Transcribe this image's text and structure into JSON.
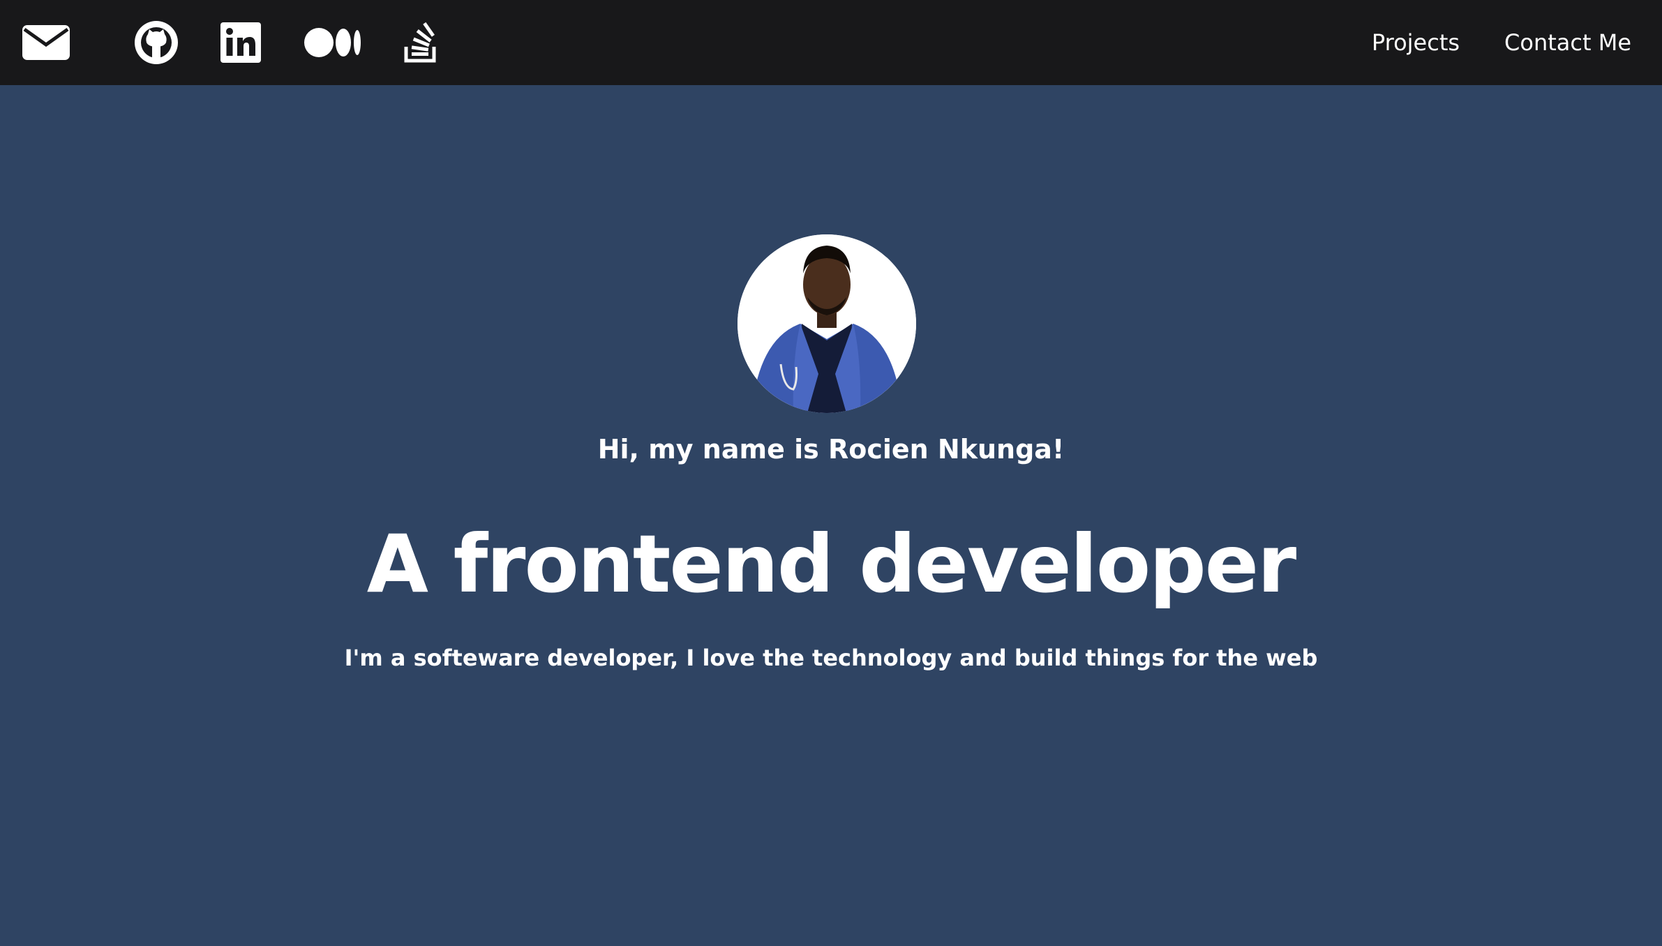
{
  "nav": {
    "icons": [
      "mail-icon",
      "github-icon",
      "linkedin-icon",
      "medium-icon",
      "stackoverflow-icon"
    ],
    "links": [
      "Projects",
      "Contact Me"
    ]
  },
  "hero": {
    "greeting": "Hi, my name is Rocien Nkunga!",
    "headline": "A frontend developer",
    "tagline": "I'm a softeware developer, I love the technology and build things for the web"
  },
  "colors": {
    "navbar_bg": "#18181a",
    "page_bg": "#2f4463",
    "text": "#ffffff"
  }
}
